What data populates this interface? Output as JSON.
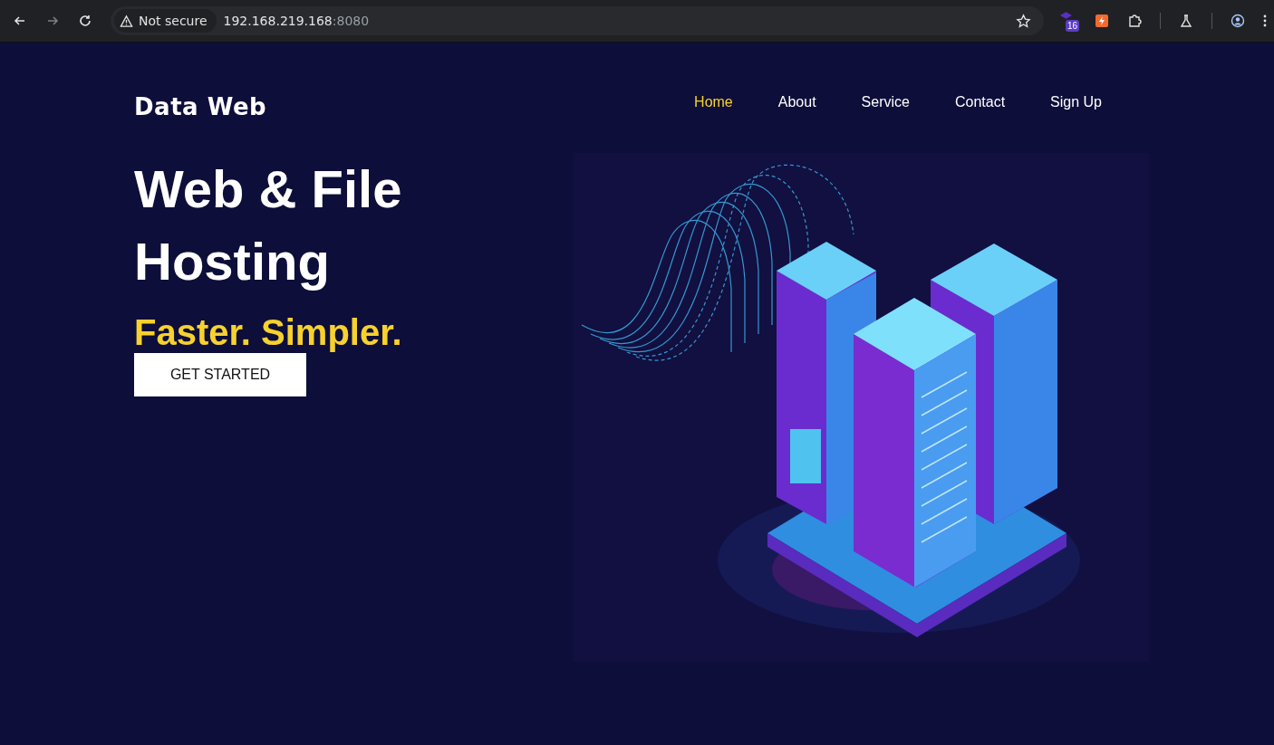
{
  "browser": {
    "security": "Not secure",
    "url_host": "192.168.219.168",
    "url_port": ":8080",
    "extension_badge": "16"
  },
  "site": {
    "logo": "Data Web",
    "nav": [
      {
        "label": "Home",
        "selected": true
      },
      {
        "label": "About",
        "selected": false
      },
      {
        "label": "Service",
        "selected": false
      },
      {
        "label": "Contact",
        "selected": false
      },
      {
        "label": "Sign Up",
        "selected": false
      }
    ]
  },
  "hero": {
    "title_lines": [
      "Web & File",
      "Hosting"
    ],
    "tagline": "Faster. Simpler.",
    "button": "GET STARTED"
  }
}
